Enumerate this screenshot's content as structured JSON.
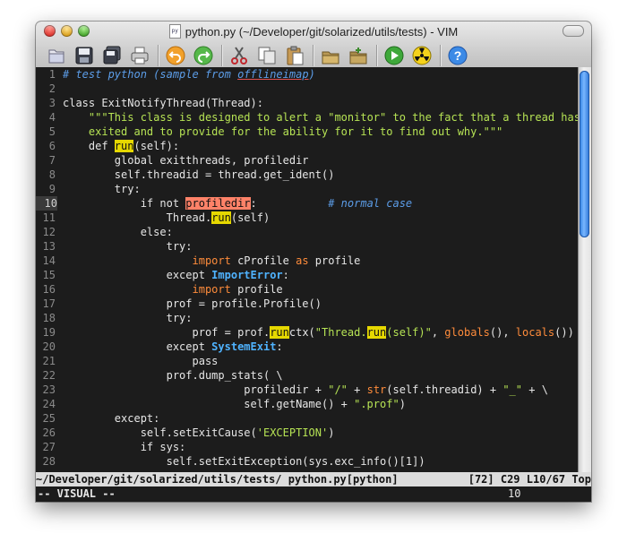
{
  "window": {
    "title": "python.py (~/Developer/git/solarized/utils/tests) - VIM",
    "proxy_icon_label": "py"
  },
  "toolbar": {
    "buttons": [
      "open-icon",
      "save-icon",
      "save-all-icon",
      "print-icon",
      "undo-icon",
      "redo-icon",
      "cut-icon",
      "copy-icon",
      "paste-icon",
      "find-icon",
      "find-replace-icon",
      "run-icon",
      "radioactive-icon",
      "help-icon"
    ]
  },
  "editor": {
    "current_line": 10,
    "lines": [
      [
        [
          "cm",
          "# test python (sample from "
        ],
        [
          "cm ul",
          "offlineimap"
        ],
        [
          "cm",
          ")"
        ]
      ],
      [],
      [
        [
          "",
          "class ExitNotifyThread(Thread):"
        ]
      ],
      [
        [
          "",
          "    "
        ],
        [
          "st",
          "\"\"\"This class is designed to alert a \"monitor\" to the fact that a thread has"
        ]
      ],
      [
        [
          "st",
          "    exited and to provide for the ability for it to find out why.\"\"\""
        ]
      ],
      [
        [
          "",
          "    def "
        ],
        [
          "hl",
          "run"
        ],
        [
          "",
          "(self):"
        ]
      ],
      [
        [
          "",
          "        global exitthreads, profiledir"
        ]
      ],
      [
        [
          "",
          "        self.threadid = thread.get_ident()"
        ]
      ],
      [
        [
          "",
          "        try:"
        ]
      ],
      [
        [
          "",
          "            if not "
        ],
        [
          "hl2",
          "profiledir"
        ],
        [
          "",
          ":           "
        ],
        [
          "cm",
          "# normal case"
        ]
      ],
      [
        [
          "",
          "                Thread."
        ],
        [
          "hl",
          "run"
        ],
        [
          "",
          "(self)"
        ]
      ],
      [
        [
          "",
          "            else:"
        ]
      ],
      [
        [
          "",
          "                try:"
        ]
      ],
      [
        [
          "",
          "                    "
        ],
        [
          "kw",
          "import"
        ],
        [
          "",
          " cProfile "
        ],
        [
          "kw",
          "as"
        ],
        [
          "",
          " profile"
        ]
      ],
      [
        [
          "",
          "                except "
        ],
        [
          "ex",
          "ImportError"
        ],
        [
          "",
          ":"
        ]
      ],
      [
        [
          "",
          "                    "
        ],
        [
          "kw",
          "import"
        ],
        [
          "",
          " profile"
        ]
      ],
      [
        [
          "",
          "                prof = profile.Profile()"
        ]
      ],
      [
        [
          "",
          "                try:"
        ]
      ],
      [
        [
          "",
          "                    prof = prof."
        ],
        [
          "hl",
          "run"
        ],
        [
          "",
          "ctx("
        ],
        [
          "st",
          "\"Thread."
        ],
        [
          "hl",
          "run"
        ],
        [
          "st",
          "(self)\""
        ],
        [
          "",
          ", "
        ],
        [
          "kw",
          "globals"
        ],
        [
          "",
          "(), "
        ],
        [
          "kw",
          "locals"
        ],
        [
          "",
          "())"
        ]
      ],
      [
        [
          "",
          "                except "
        ],
        [
          "ex",
          "SystemExit"
        ],
        [
          "",
          ":"
        ]
      ],
      [
        [
          "",
          "                    pass"
        ]
      ],
      [
        [
          "",
          "                prof.dump_stats( \\"
        ]
      ],
      [
        [
          "",
          "                            profiledir + "
        ],
        [
          "st",
          "\"/\""
        ],
        [
          "",
          " + "
        ],
        [
          "kw",
          "str"
        ],
        [
          "",
          "(self.threadid) + "
        ],
        [
          "st",
          "\"_\""
        ],
        [
          "",
          " + \\"
        ]
      ],
      [
        [
          "",
          "                            self.getName() + "
        ],
        [
          "st",
          "\".prof\""
        ],
        [
          "",
          ")"
        ]
      ],
      [
        [
          "",
          "        except:"
        ]
      ],
      [
        [
          "",
          "            self.setExitCause("
        ],
        [
          "st",
          "'EXCEPTION'"
        ],
        [
          "",
          ")"
        ]
      ],
      [
        [
          "",
          "            if sys:"
        ]
      ],
      [
        [
          "",
          "                self.setExitException(sys.exc_info()[1])"
        ]
      ]
    ]
  },
  "statusline": {
    "left": "~/Developer/git/solarized/utils/tests/ python.py[python]",
    "right": "[72] C29 L10/67 Top"
  },
  "cmdline": {
    "mode": "-- VISUAL --",
    "count": "10"
  },
  "scrollbar": {
    "position_fraction": 0.0,
    "visible_fraction": 0.418
  }
}
